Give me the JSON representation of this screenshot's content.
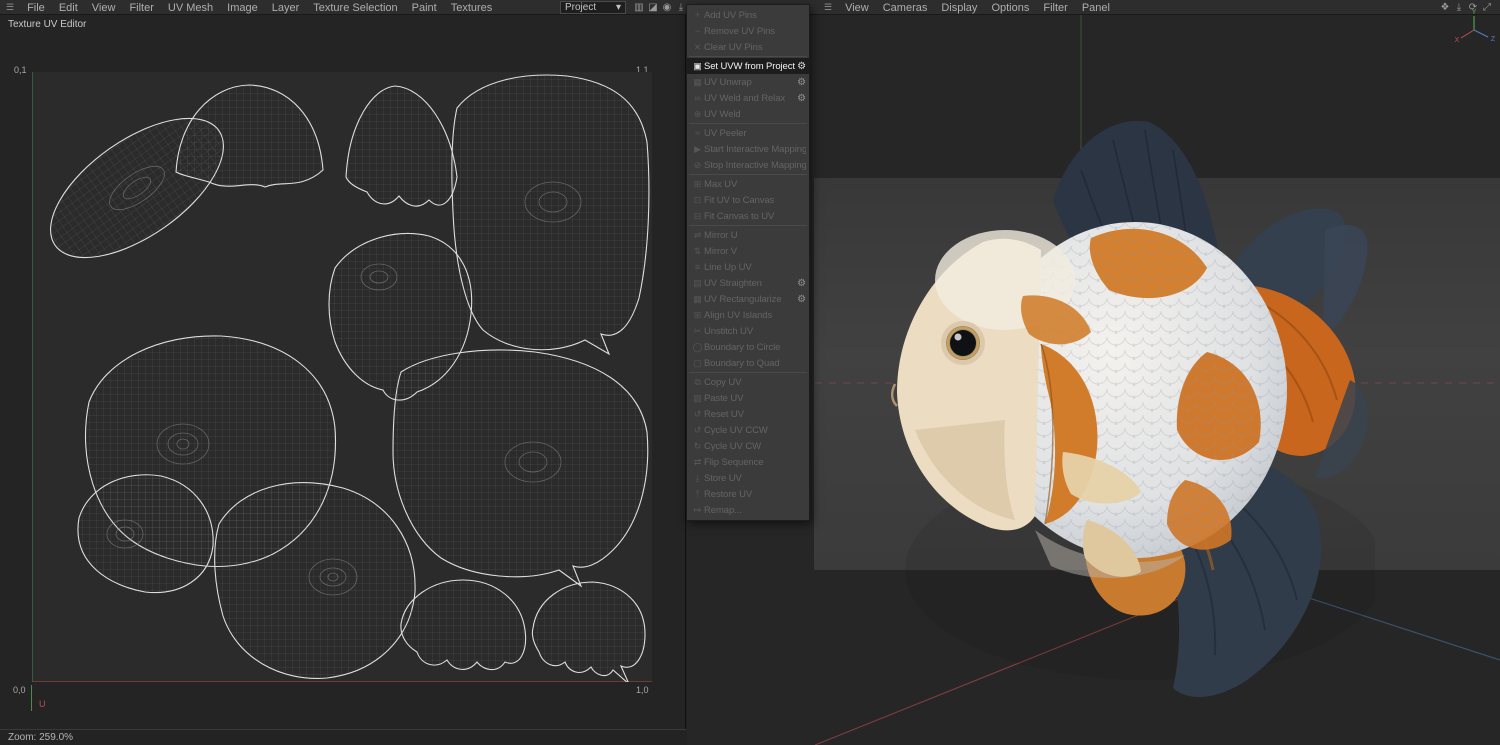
{
  "left_panel": {
    "hamburger": "☰",
    "menu": [
      "File",
      "Edit",
      "View",
      "Filter",
      "UV Mesh",
      "Image",
      "Layer",
      "Texture Selection",
      "Paint",
      "Textures"
    ],
    "project_select": {
      "value": "Project",
      "caret": "▾"
    },
    "toolbar_icons": {
      "stats": "▥",
      "lock": "◪",
      "eye": "◉",
      "download": "⤓"
    },
    "panel_title": "Texture UV Editor",
    "uv_canvas": {
      "corner_tl": "0,1",
      "corner_tr": "1,1",
      "corner_bl": "0,0",
      "corner_br": "1,0",
      "axis_u": "U"
    },
    "status_zoom": "Zoom: 259.0%"
  },
  "context_menu": {
    "gear": "⚙",
    "items": [
      {
        "label": "Add UV Pins",
        "icon": "+"
      },
      {
        "label": "Remove UV Pins",
        "icon": "−"
      },
      {
        "label": "Clear UV Pins",
        "icon": "✕"
      },
      {
        "label": "Set UVW from Projection",
        "icon": "▣"
      },
      {
        "label": "UV Unwrap",
        "icon": "▦"
      },
      {
        "label": "UV Weld and Relax",
        "icon": "∞"
      },
      {
        "label": "UV Weld",
        "icon": "⊕"
      },
      {
        "label": "UV Peeler",
        "icon": "≈"
      },
      {
        "label": "Start Interactive Mapping",
        "icon": "▶"
      },
      {
        "label": "Stop Interactive Mapping",
        "icon": "⊘"
      },
      {
        "label": "Max UV",
        "icon": "⊞"
      },
      {
        "label": "Fit UV to Canvas",
        "icon": "⊡"
      },
      {
        "label": "Fit Canvas to UV",
        "icon": "⊟"
      },
      {
        "label": "Mirror U",
        "icon": "⇌"
      },
      {
        "label": "Mirror V",
        "icon": "⇅"
      },
      {
        "label": "Line Up UV",
        "icon": "≡"
      },
      {
        "label": "UV Straighten",
        "icon": "▤"
      },
      {
        "label": "UV Rectangularize",
        "icon": "▦"
      },
      {
        "label": "Align UV Islands",
        "icon": "⊞"
      },
      {
        "label": "Unstitch UV",
        "icon": "✂"
      },
      {
        "label": "Boundary to Circle",
        "icon": "◯"
      },
      {
        "label": "Boundary to Quad",
        "icon": "▢"
      },
      {
        "label": "Copy UV",
        "icon": "⧉"
      },
      {
        "label": "Paste UV",
        "icon": "▧"
      },
      {
        "label": "Reset UV",
        "icon": "↺"
      },
      {
        "label": "Cycle UV CCW",
        "icon": "↺"
      },
      {
        "label": "Cycle UV CW",
        "icon": "↻"
      },
      {
        "label": "Flip Sequence",
        "icon": "⇄"
      },
      {
        "label": "Store UV",
        "icon": "⤓"
      },
      {
        "label": "Restore UV",
        "icon": "⤒"
      },
      {
        "label": "Remap...",
        "icon": "↦"
      }
    ]
  },
  "right_panel": {
    "hamburger": "☰",
    "menu": [
      "View",
      "Cameras",
      "Display",
      "Options",
      "Filter",
      "Panel"
    ],
    "toolbar_icons": {
      "pan": "❖",
      "download": "⤓",
      "sync": "⟳",
      "expand": "⤢"
    },
    "gizmo": {
      "x": "X",
      "y": "Y",
      "z": "Z"
    }
  }
}
